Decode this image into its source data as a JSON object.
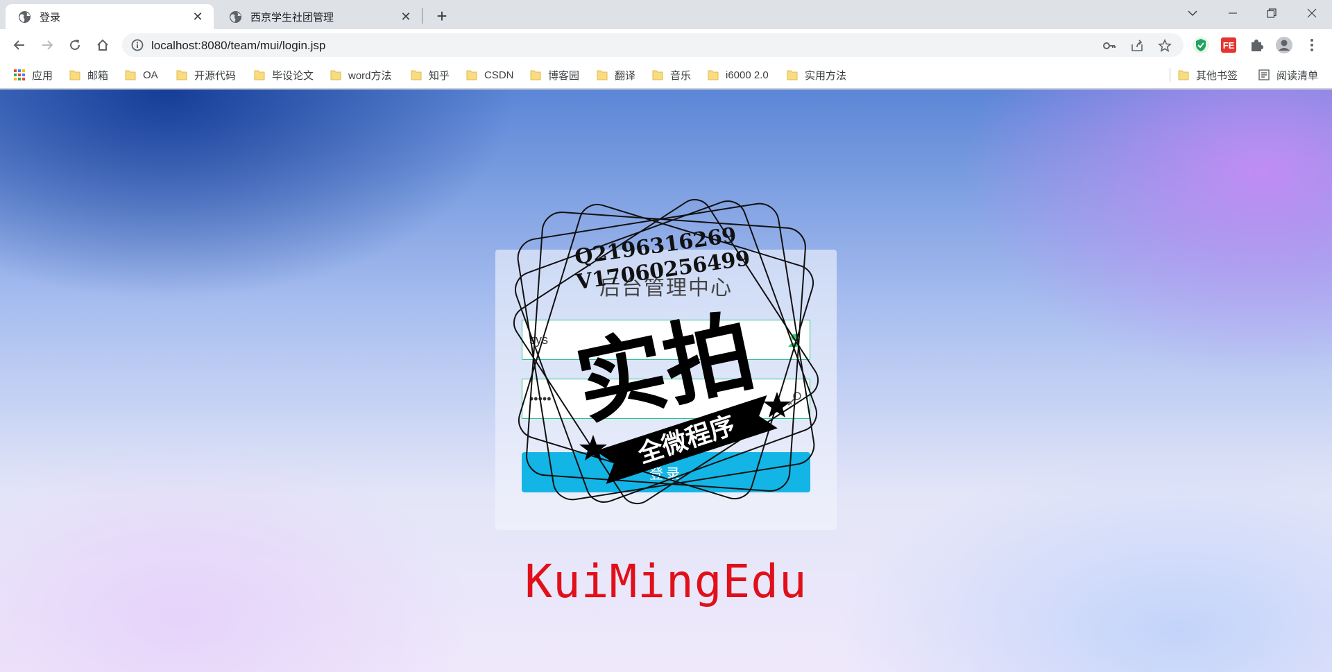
{
  "tabs": [
    {
      "title": "登录",
      "active": true
    },
    {
      "title": "西京学生社团管理",
      "active": false
    }
  ],
  "address_bar": {
    "url": "localhost:8080/team/mui/login.jsp"
  },
  "bookmarks": {
    "items": [
      "应用",
      "邮箱",
      "OA",
      "开源代码",
      "毕设论文",
      "word方法",
      "知乎",
      "CSDN",
      "博客园",
      "翻译",
      "音乐",
      "i6000 2.0",
      "实用方法"
    ],
    "other": "其他书签",
    "reading_list": "阅读清单"
  },
  "login": {
    "title": "后台管理中心",
    "username_value": "sys",
    "password_value": "•••••",
    "submit_label": "登录"
  },
  "brand": "KuiMingEdu",
  "watermark": {
    "line1": "Q2196316269",
    "line2": "V17060256499",
    "main_text": "实拍",
    "banner_text": "全微程序"
  },
  "colors": {
    "accent": "#12b5e5",
    "field_border": "#27c38d",
    "brand_red": "#e0101a"
  }
}
